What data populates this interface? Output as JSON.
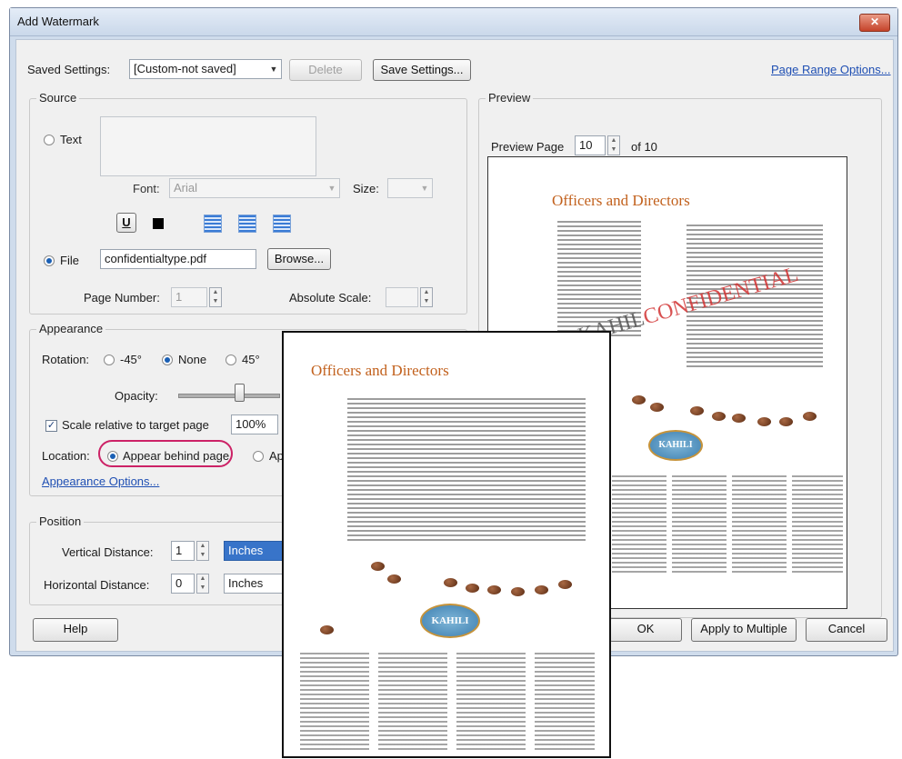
{
  "window": {
    "title": "Add Watermark",
    "close_glyph": "✕"
  },
  "saved_settings": {
    "label": "Saved Settings:",
    "value": "[Custom-not saved]",
    "delete_label": "Delete",
    "save_label": "Save Settings..."
  },
  "page_range_link": "Page Range Options...",
  "source": {
    "title": "Source",
    "text_label": "Text",
    "font_label": "Font:",
    "font_value": "Arial",
    "size_label": "Size:",
    "underline_glyph": "U",
    "file_label": "File",
    "file_value": "confidentialtype.pdf",
    "browse_label": "Browse...",
    "page_number_label": "Page Number:",
    "page_number_value": "1",
    "abs_scale_label": "Absolute Scale:"
  },
  "appearance": {
    "title": "Appearance",
    "rotation_label": "Rotation:",
    "rot_neg45": "-45°",
    "rot_none": "None",
    "rot_45": "45°",
    "opacity_label": "Opacity:",
    "scale_label": "Scale relative to target page",
    "scale_value": "100%",
    "location_label": "Location:",
    "behind_label": "Appear behind page",
    "on_top_partial": "Ap",
    "options_link": "Appearance Options..."
  },
  "position": {
    "title": "Position",
    "vertical_label": "Vertical Distance:",
    "vertical_value": "1",
    "vertical_unit": "Inches",
    "horizontal_label": "Horizontal Distance:",
    "horizontal_value": "0",
    "horizontal_unit": "Inches"
  },
  "preview": {
    "title": "Preview",
    "page_label": "Preview Page",
    "page_value": "10",
    "of_label": "of 10",
    "watermark_a": "KAHIL",
    "watermark_b": "CONFIDENTIAL"
  },
  "document": {
    "heading": "Officers and Directors",
    "logo_text": "KAHILI"
  },
  "footer": {
    "help": "Help",
    "ok": "OK",
    "apply_multiple": "Apply to Multiple",
    "cancel": "Cancel"
  },
  "colors": {
    "accent_link": "#1f4fb3",
    "highlight_circle": "#cc2266",
    "doc_heading": "#c2611d",
    "watermark_red": "#d23333"
  }
}
